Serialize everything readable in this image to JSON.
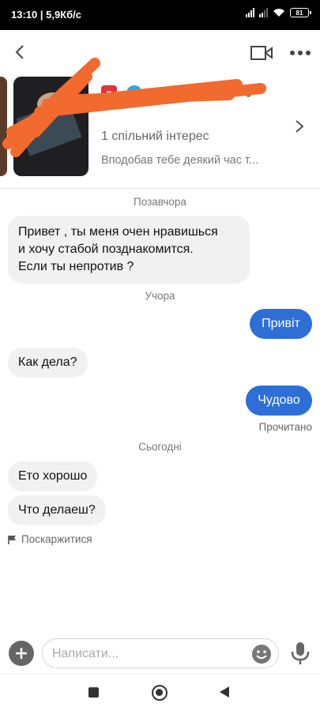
{
  "status_bar": {
    "time_speed": "13:10 | 5,9Кб/с",
    "battery": "81"
  },
  "profile": {
    "shared_interest": "1 спільний інтерес",
    "liked_note": "Вподобав тебе деякий час т..."
  },
  "chat": {
    "sections": [
      {
        "date": "Позавчора"
      },
      {
        "date": "Учора"
      },
      {
        "date": "Сьогодні"
      }
    ],
    "messages": [
      {
        "from": "them",
        "text": "Привет , ты меня очен нравишься\nи хочу стабой позднакомится.\nЕсли ты непротив ?"
      },
      {
        "from": "me",
        "text": "Привіт"
      },
      {
        "from": "them",
        "text": "Как дела?"
      },
      {
        "from": "me",
        "text": "Чудово"
      },
      {
        "from": "them",
        "text": "Ето хорошо"
      },
      {
        "from": "them",
        "text": "Что делаеш?"
      }
    ],
    "read_status": "Прочитано",
    "report_label": "Поскаржитися"
  },
  "composer": {
    "placeholder": "Написати..."
  },
  "colors": {
    "outgoing_bubble": "#2e6fd6",
    "incoming_bubble": "#f1f1f1",
    "online": "#4caf50",
    "redaction": "#f26a2e"
  }
}
